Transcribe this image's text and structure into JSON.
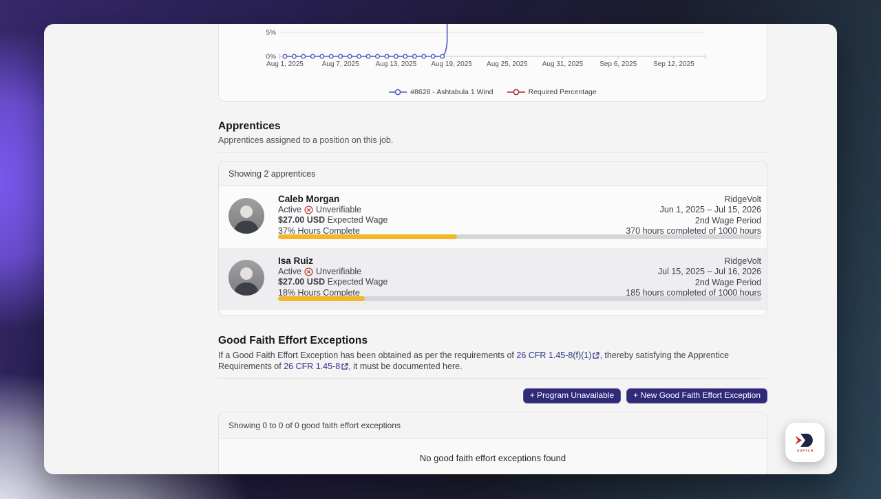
{
  "chart_data": {
    "type": "line",
    "title": "",
    "xlabel": "",
    "ylabel": "",
    "y_tick_labels": [
      "5%",
      "0%"
    ],
    "x_tick_labels": [
      "Aug 1, 2025",
      "Aug 7, 2025",
      "Aug 13, 2025",
      "Aug 19, 2025",
      "Aug 25, 2025",
      "Aug 31, 2025",
      "Sep 6, 2025",
      "Sep 12, 2025"
    ],
    "point_interval_days": 1,
    "grid": "horizontal",
    "legend_position": "bottom",
    "ylim_visible": [
      0,
      6.6
    ],
    "series": [
      {
        "name": "#8628 - Ashtabula 1 Wind",
        "color": "#4c59c2",
        "values": [
          0,
          0,
          0,
          0,
          0,
          0,
          0,
          0,
          0,
          0,
          0,
          0,
          0,
          0,
          0,
          0,
          0,
          0
        ],
        "spike": "line rises vertically above 5% (clipped at top of view) around Aug 19, 2025"
      },
      {
        "name": "Required Percentage",
        "color": "#9e2b33",
        "values": [],
        "note": "line sits above the visible clipped region; only shown in legend"
      }
    ]
  },
  "apprentices": {
    "heading": "Apprentices",
    "description": "Apprentices assigned to a position on this job.",
    "count_label": "Showing 2 apprentices",
    "rows": [
      {
        "name": "Caleb Morgan",
        "status": "Active",
        "verification": "Unverifiable",
        "wage_amount": "$27.00 USD",
        "wage_label": "Expected Wage",
        "hours_label": "37% Hours Complete",
        "progress_pct": 37,
        "employer": "RidgeVolt",
        "date_range": "Jun 1, 2025 – Jul 15, 2026",
        "wage_period": "2nd Wage Period",
        "hours_completed": "370 hours completed of 1000 hours"
      },
      {
        "name": "Isa Ruiz",
        "status": "Active",
        "verification": "Unverifiable",
        "wage_amount": "$27.00 USD",
        "wage_label": "Expected Wage",
        "hours_label": "18% Hours Complete",
        "progress_pct": 18,
        "employer": "RidgeVolt",
        "date_range": "Jul 15, 2025 – Jul 16, 2026",
        "wage_period": "2nd Wage Period",
        "hours_completed": "185 hours completed of 1000 hours"
      }
    ]
  },
  "gfe": {
    "heading": "Good Faith Effort Exceptions",
    "desc_part1": "If a Good Faith Effort Exception has been obtained as per the requirements of ",
    "link1": "26 CFR 1.45-8(f)(1)",
    "desc_part2": ", thereby satisfying the Apprentice Requirements of ",
    "link2": "26 CFR 1.45-8",
    "desc_part3": ", it must be documented here.",
    "buttons": {
      "program_unavailable": "+ Program Unavailable",
      "new_exception": "+ New Good Faith Effort Exception"
    },
    "table_header": "Showing 0 to 0 of 0 good faith effort exceptions",
    "empty_message": "No good faith effort exceptions found"
  },
  "badge": {
    "label": "DSPTCH"
  },
  "colors": {
    "accent_button": "#2e2a78",
    "link": "#2d3282",
    "progress_fill": "#f3b72b",
    "progress_track": "#d6d6da",
    "status_icon_red": "#bf3a3a",
    "series_blue": "#4c59c2",
    "series_red": "#9e2b33"
  }
}
